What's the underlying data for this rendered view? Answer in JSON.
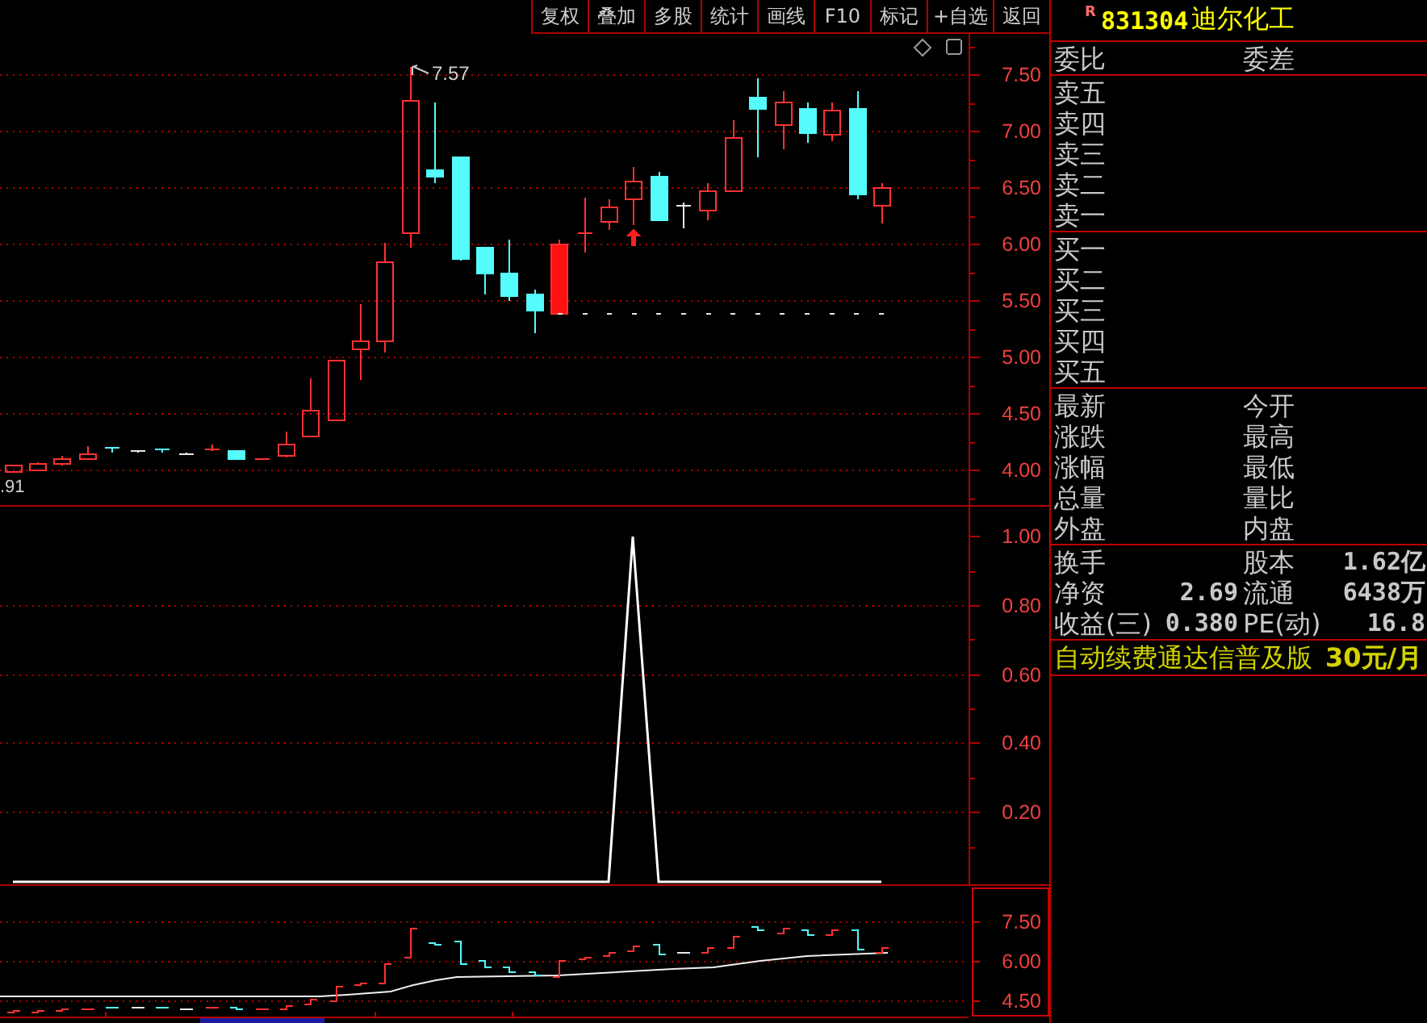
{
  "toolbar": {
    "buttons": [
      "复权",
      "叠加",
      "多股",
      "统计",
      "画线",
      "F10",
      "标记",
      "+自选",
      "返回"
    ]
  },
  "price_chart": {
    "high_label": "7.57",
    "low_label": ".91",
    "chart_data": {
      "type": "candlestick",
      "categories": [
        null,
        null,
        null,
        null,
        null,
        null,
        null,
        null,
        null,
        null,
        null,
        null,
        null,
        null,
        null,
        null,
        null,
        null,
        null,
        null,
        null,
        null,
        null,
        null,
        null,
        null,
        null,
        null,
        null,
        null,
        null,
        null,
        null,
        null,
        null,
        null,
        null,
        null,
        null
      ],
      "ohlc": [
        [
          3.99,
          4.04,
          3.99,
          4.04
        ],
        [
          4.01,
          4.07,
          4.0,
          4.06
        ],
        [
          4.06,
          4.13,
          4.05,
          4.11
        ],
        [
          4.11,
          4.22,
          4.1,
          4.15
        ],
        [
          4.21,
          4.21,
          4.16,
          4.19
        ],
        [
          4.17,
          4.18,
          4.16,
          4.17
        ],
        [
          4.19,
          4.19,
          4.16,
          4.17
        ],
        [
          4.15,
          4.16,
          4.14,
          4.15
        ],
        [
          4.18,
          4.23,
          4.18,
          4.19
        ],
        [
          4.18,
          4.18,
          4.1,
          4.1
        ],
        [
          4.1,
          4.11,
          4.1,
          4.11
        ],
        [
          4.13,
          4.34,
          4.12,
          4.23
        ],
        [
          4.3,
          4.82,
          4.3,
          4.53
        ],
        [
          4.44,
          4.98,
          4.44,
          4.97
        ],
        [
          5.08,
          5.47,
          4.8,
          5.15
        ],
        [
          5.15,
          6.02,
          5.05,
          5.85
        ],
        [
          6.11,
          7.57,
          5.98,
          7.27
        ],
        [
          6.66,
          7.26,
          6.55,
          6.61
        ],
        [
          6.77,
          6.78,
          5.86,
          5.87
        ],
        [
          5.97,
          5.97,
          5.56,
          5.75
        ],
        [
          5.74,
          6.04,
          5.5,
          5.55
        ],
        [
          5.56,
          5.6,
          5.22,
          5.42
        ],
        [
          5.39,
          6.04,
          5.39,
          6.0
        ],
        [
          6.09,
          6.42,
          5.93,
          6.1
        ],
        [
          6.2,
          6.4,
          6.13,
          6.33
        ],
        [
          6.4,
          6.69,
          6.17,
          6.56
        ],
        [
          6.6,
          6.65,
          6.22,
          6.22
        ],
        [
          6.34,
          6.37,
          6.14,
          6.34
        ],
        [
          6.31,
          6.55,
          6.22,
          6.47
        ],
        [
          6.48,
          7.11,
          6.48,
          6.94
        ],
        [
          7.3,
          7.48,
          6.77,
          7.2
        ],
        [
          7.06,
          7.36,
          6.85,
          7.26
        ],
        [
          7.2,
          7.26,
          6.9,
          6.99
        ],
        [
          6.97,
          7.26,
          6.92,
          7.19
        ],
        [
          7.2,
          7.36,
          6.4,
          6.44
        ],
        [
          6.34,
          6.54,
          6.19,
          6.5
        ],
        null,
        null,
        null
      ],
      "ylim": [
        3.69,
        7.86
      ],
      "yticks": [
        {
          "value": 7.5,
          "label": "7.50"
        },
        {
          "value": 7,
          "label": "7.00"
        },
        {
          "value": 6.5,
          "label": "6.50"
        },
        {
          "value": 6,
          "label": "6.00"
        },
        {
          "value": 5.5,
          "label": "5.50"
        },
        {
          "value": 5,
          "label": "5.00"
        },
        {
          "value": 4.5,
          "label": "4.50"
        },
        {
          "value": 4,
          "label": "4.00"
        }
      ],
      "grid": true,
      "ref_lines": [
        {
          "axis": "y",
          "value": 5.39
        }
      ]
    }
  },
  "indicator_chart": {
    "chart_data": {
      "type": "line",
      "categories": [
        null,
        null,
        null,
        null,
        null,
        null,
        null,
        null,
        null,
        null,
        null,
        null,
        null,
        null,
        null,
        null,
        null,
        null,
        null,
        null,
        null,
        null,
        null,
        null,
        null,
        null,
        null,
        null,
        null,
        null,
        null,
        null,
        null,
        null,
        null,
        null,
        null,
        null,
        null
      ],
      "values": [
        0,
        0,
        0,
        0,
        0,
        0,
        0,
        0,
        0,
        0,
        0,
        0,
        0,
        0,
        0,
        0,
        0,
        0,
        0,
        0,
        0,
        0,
        0,
        0,
        0,
        1,
        0,
        0,
        0,
        0,
        0,
        0,
        0,
        0,
        0,
        0,
        null,
        null,
        null
      ],
      "ylim": [
        0,
        1.09
      ],
      "yticks": [
        {
          "value": 0.2,
          "label": "0.20"
        },
        {
          "value": 0.4,
          "label": "0.40"
        },
        {
          "value": 0.6,
          "label": "0.60"
        },
        {
          "value": 0.8,
          "label": "0.80"
        },
        {
          "value": 1,
          "label": "1.00"
        }
      ],
      "grid": true
    }
  },
  "overview_chart": {
    "axis_labels": [
      "7.50",
      "6.00",
      "4.50"
    ]
  },
  "quote_panel": {
    "badge": "R",
    "code": "831304",
    "name": "迪尔化工",
    "sections": [
      {
        "rows": [
          {
            "cells": [
              {
                "label": "委比"
              },
              {
                "label": "委差"
              }
            ]
          }
        ]
      },
      {
        "rows": [
          {
            "cells": [
              {
                "label": "卖五"
              }
            ]
          },
          {
            "cells": [
              {
                "label": "卖四"
              }
            ]
          },
          {
            "cells": [
              {
                "label": "卖三"
              }
            ]
          },
          {
            "cells": [
              {
                "label": "卖二"
              }
            ]
          },
          {
            "cells": [
              {
                "label": "卖一"
              }
            ]
          }
        ]
      },
      {
        "rows": [
          {
            "cells": [
              {
                "label": "买一"
              }
            ]
          },
          {
            "cells": [
              {
                "label": "买二"
              }
            ]
          },
          {
            "cells": [
              {
                "label": "买三"
              }
            ]
          },
          {
            "cells": [
              {
                "label": "买四"
              }
            ]
          },
          {
            "cells": [
              {
                "label": "买五"
              }
            ]
          }
        ]
      },
      {
        "rows": [
          {
            "cells": [
              {
                "label": "最新"
              },
              {
                "label": "今开"
              }
            ]
          },
          {
            "cells": [
              {
                "label": "涨跌"
              },
              {
                "label": "最高"
              }
            ]
          },
          {
            "cells": [
              {
                "label": "涨幅"
              },
              {
                "label": "最低"
              }
            ]
          },
          {
            "cells": [
              {
                "label": "总量"
              },
              {
                "label": "量比"
              }
            ]
          },
          {
            "cells": [
              {
                "label": "外盘"
              },
              {
                "label": "内盘"
              }
            ]
          }
        ]
      },
      {
        "rows": [
          {
            "cells": [
              {
                "label": "换手"
              },
              {
                "label": "股本",
                "value": "1.62亿"
              }
            ]
          },
          {
            "cells": [
              {
                "label": "净资",
                "value": "2.69"
              },
              {
                "label": "流通",
                "value": "6438万"
              }
            ]
          },
          {
            "cells": [
              {
                "label": "收益(三)",
                "value": "0.380"
              },
              {
                "label": "PE(动)",
                "value": "16.8"
              }
            ]
          }
        ]
      }
    ],
    "promo": {
      "text": "自动续费通达信普及版",
      "price": "30元/月"
    }
  }
}
